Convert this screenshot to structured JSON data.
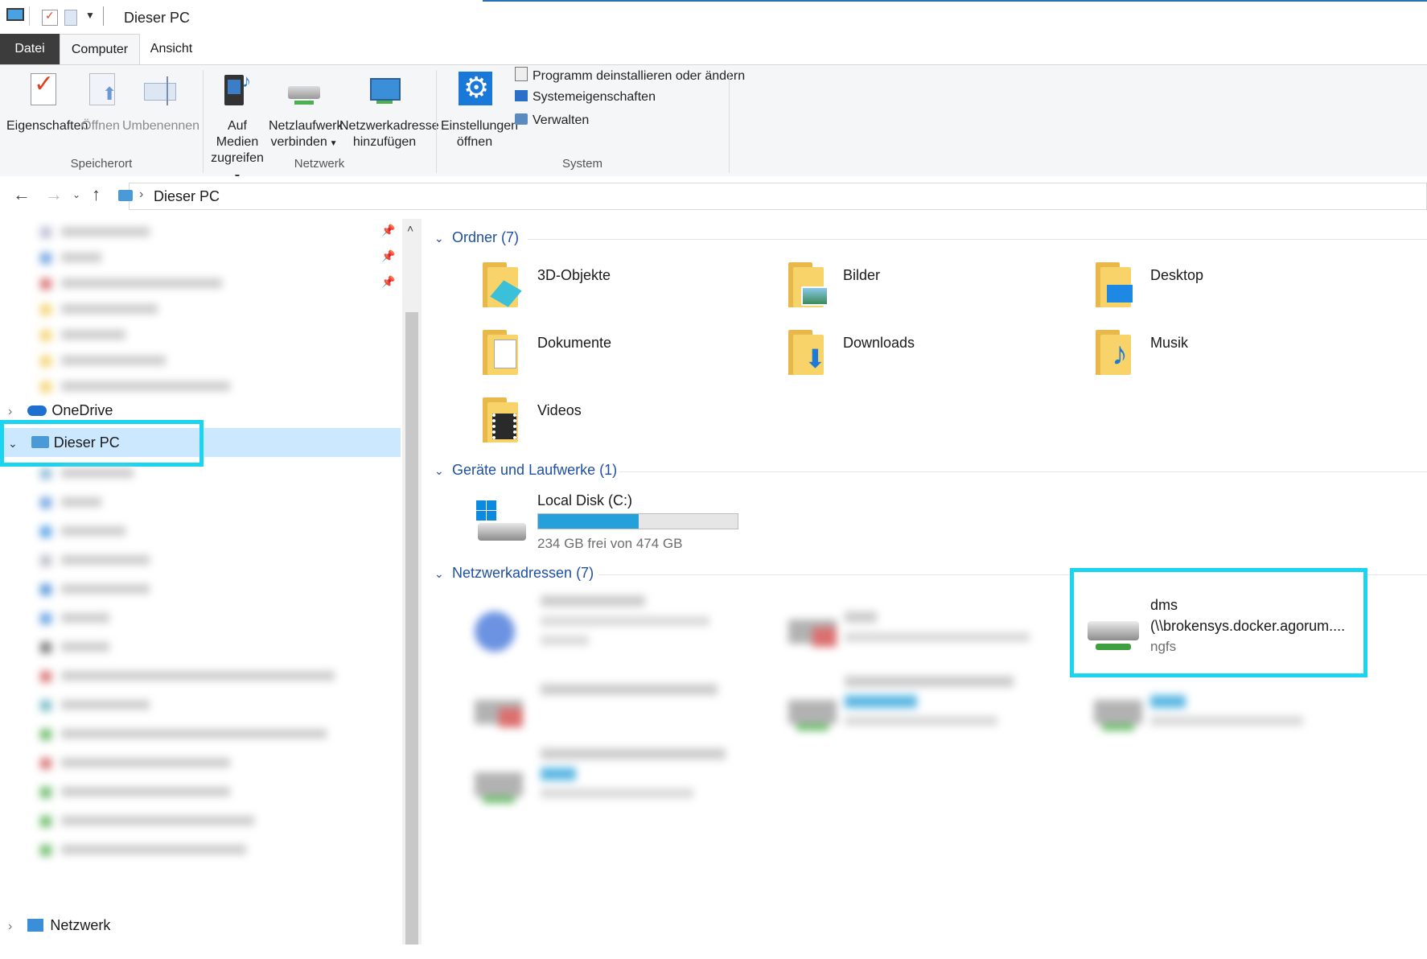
{
  "window": {
    "title": "Dieser PC"
  },
  "ribbon_tabs": [
    {
      "label": "Datei"
    },
    {
      "label": "Computer"
    },
    {
      "label": "Ansicht"
    }
  ],
  "ribbon": {
    "groups": [
      {
        "label": "Speicherort",
        "buttons": [
          {
            "label": "Eigenschaften",
            "disabled": false
          },
          {
            "label": "Öffnen",
            "disabled": true
          },
          {
            "label": "Umbenennen",
            "disabled": true
          }
        ]
      },
      {
        "label": "Netzwerk",
        "buttons": [
          {
            "line1": "Auf Medien",
            "line2": "zugreifen"
          },
          {
            "line1": "Netzlaufwerk",
            "line2": "verbinden"
          },
          {
            "line1": "Netzwerkadresse",
            "line2": "hinzufügen"
          }
        ]
      },
      {
        "label": "System",
        "settings": {
          "line1": "Einstellungen",
          "line2": "öffnen"
        },
        "items": [
          {
            "label": "Programm deinstallieren oder ändern"
          },
          {
            "label": "Systemeigenschaften"
          },
          {
            "label": "Verwalten"
          }
        ]
      }
    ]
  },
  "address": {
    "path": "Dieser PC"
  },
  "tree": {
    "onedrive": "OneDrive",
    "this_pc": "Dieser PC",
    "network": "Netzwerk"
  },
  "sections": {
    "folders": {
      "label": "Ordner (7)",
      "items": [
        {
          "label": "3D-Objekte"
        },
        {
          "label": "Bilder"
        },
        {
          "label": "Desktop"
        },
        {
          "label": "Dokumente"
        },
        {
          "label": "Downloads"
        },
        {
          "label": "Musik"
        },
        {
          "label": "Videos"
        }
      ]
    },
    "devices": {
      "label": "Geräte und Laufwerke (1)",
      "items": [
        {
          "label": "Local Disk (C:)",
          "free": "234 GB frei von 474 GB",
          "used_fraction": 0.506
        }
      ]
    },
    "network": {
      "label": "Netzwerkadressen (7)",
      "highlighted": {
        "name": "dms",
        "path": "(\\\\brokensys.docker.agorum....",
        "fs": "ngfs"
      }
    }
  },
  "colors": {
    "accent": "#1e4fa0",
    "highlight": "#1ad4f0",
    "progress": "#26a0da"
  }
}
